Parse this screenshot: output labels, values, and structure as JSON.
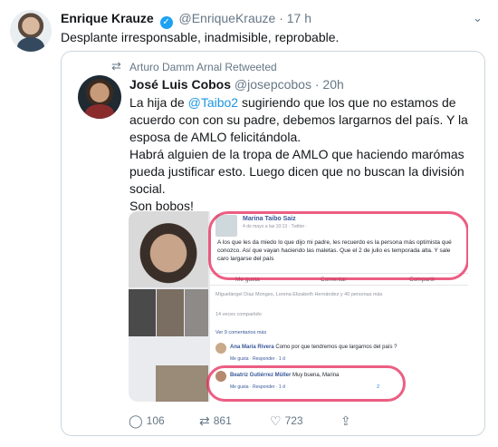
{
  "tweet": {
    "author_name": "Enrique Krauze",
    "author_handle": "@EnriqueKrauze",
    "separator": "·",
    "time": "17 h",
    "text": "Desplante irresponsable, inadmisible, reprobable."
  },
  "retweet_label": "Arturo Damm Arnal Retweeted",
  "quoted": {
    "author_name": "José Luis Cobos",
    "author_handle": "@josepcobos",
    "separator": "·",
    "time": "20h",
    "lines": [
      {
        "before": "La hija de ",
        "mention": "@Taibo2",
        "after": " sugiriendo que los que no estamos de acuerdo con con su padre, debemos largarnos del país. Y la esposa de AMLO felicitándola."
      },
      {
        "before": "Habrá alguien de la tropa de AMLO que haciendo marómas pueda justificar esto. Luego dicen que no buscan la división social.",
        "mention": "",
        "after": ""
      },
      {
        "before": "Son bobos!",
        "mention": "",
        "after": ""
      }
    ],
    "image": {
      "fb_name": "Marina Taibo Saiz",
      "fb_meta": "4 de mayo a las 10:13 · Twitter ·",
      "fb_text": "A los que les da miedo lo que dijo mi padre, les recuerdo es la persona más optimista qué conozco. Así que vayan haciendo las maletas. Que el 2 de julio es temporada alta. Y sale caro largarse del país",
      "like": "Me gusta",
      "comment": "Comentar",
      "share": "Compartir",
      "reactions": "Miguelángel Díaz Monges, Lorena Elizabeth Hernández y 40 personas más",
      "shared": "14 veces compartido",
      "more_comments": "Ver 9 comentarios más",
      "comment1_name": "Ana María Rivera",
      "comment1_text": "Como por que tendremos que largarnos del país ?",
      "comment1_meta": "Me gusta · Responder · 1 d",
      "comment2_name": "Beatriz Gutiérrez Müller",
      "comment2_text": "Muy buena, Marina",
      "comment2_meta": "Me gusta · Responder · 1 d",
      "comment2_count": "2"
    },
    "actions": {
      "replies": "106",
      "retweets": "861",
      "likes": "723"
    }
  },
  "colors": {
    "link": "#1b95e0",
    "muted": "#657786",
    "verified": "#1da1f2",
    "highlight": "#e6285a"
  },
  "icons": [
    "verified-icon",
    "chevron-down-icon",
    "retweet-icon",
    "reply-icon",
    "like-icon",
    "share-icon"
  ]
}
